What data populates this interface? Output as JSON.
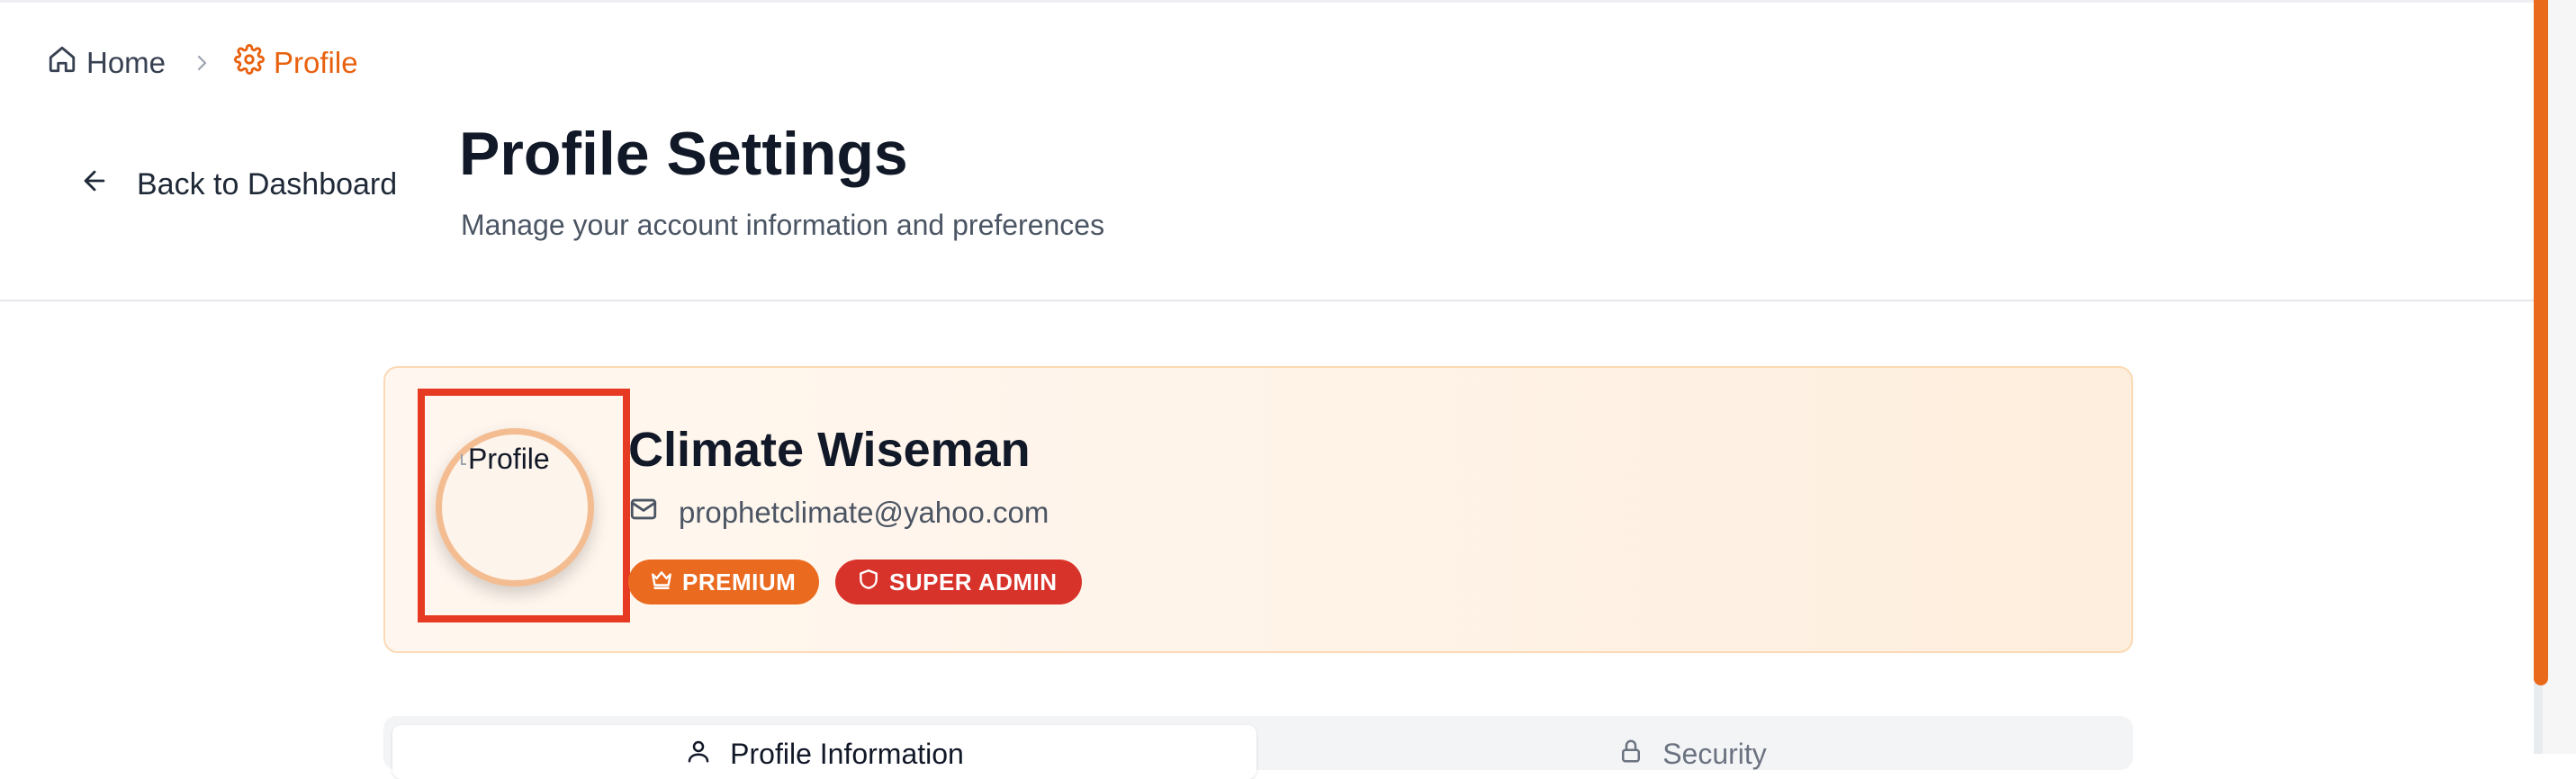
{
  "breadcrumb": {
    "home_label": "Home",
    "current_label": "Profile",
    "home_icon": "home-icon",
    "separator_icon": "chevron-right-icon",
    "current_icon": "gear-icon"
  },
  "header": {
    "back_label": "Back to Dashboard",
    "back_icon": "arrow-left-icon",
    "title": "Profile Settings",
    "subtitle": "Manage your account information and preferences"
  },
  "profile": {
    "avatar_alt": "Profile",
    "name": "Climate Wiseman",
    "email": "prophetclimate@yahoo.com",
    "email_icon": "mail-icon",
    "badges": [
      {
        "label": "PREMIUM",
        "icon": "crown-icon",
        "color": "#ea6b20"
      },
      {
        "label": "SUPER ADMIN",
        "icon": "shield-icon",
        "color": "#d8332b"
      }
    ]
  },
  "tabs": [
    {
      "label": "Profile Information",
      "icon": "user-icon",
      "active": true
    },
    {
      "label": "Security",
      "icon": "lock-icon",
      "active": false
    }
  ],
  "colors": {
    "accent": "#e8610f",
    "highlight_outline": "#e63b22",
    "scrollbar_thumb": "#ea6a1b"
  }
}
